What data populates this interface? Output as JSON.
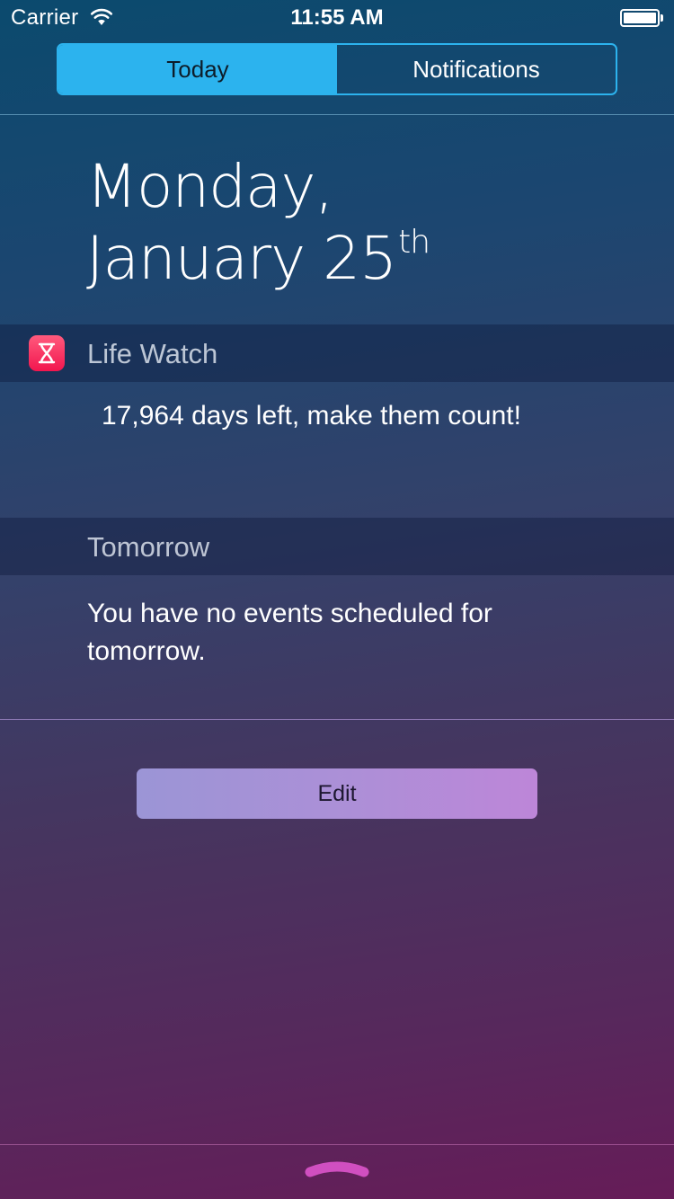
{
  "status_bar": {
    "carrier": "Carrier",
    "time": "11:55 AM"
  },
  "tabs": {
    "items": [
      {
        "label": "Today",
        "selected": true
      },
      {
        "label": "Notifications",
        "selected": false
      }
    ]
  },
  "date": {
    "weekday": "Monday,",
    "month_day": "January 25",
    "ordinal": "th"
  },
  "widgets": {
    "life_watch": {
      "title": "Life Watch",
      "icon": "hourglass-icon",
      "text": "17,964 days left, make them count!"
    },
    "tomorrow": {
      "title": "Tomorrow",
      "text": "You have no events scheduled for tomorrow."
    }
  },
  "edit_button": {
    "label": "Edit"
  },
  "colors": {
    "accent": "#2cb3ee",
    "app_icon": "#f2164e",
    "grabber": "#d04fc0"
  }
}
